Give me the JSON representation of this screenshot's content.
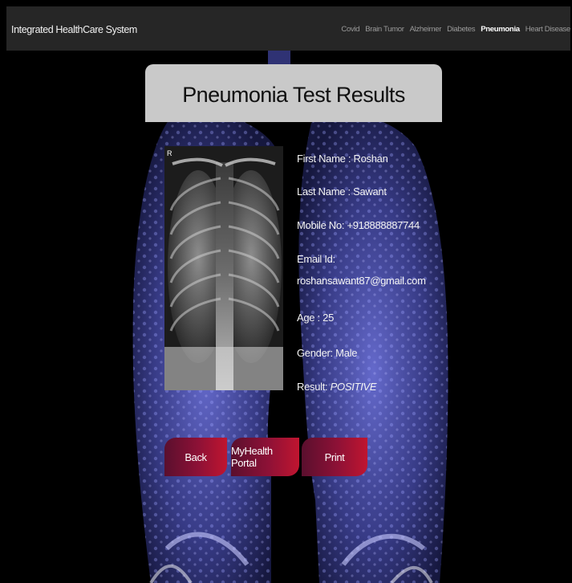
{
  "navbar": {
    "brand": "Integrated HealthCare System",
    "links": [
      "Covid",
      "Brain Tumor",
      "Alzheimer",
      "Diabetes",
      "Pneumonia",
      "Heart Disease"
    ],
    "active": "Pneumonia"
  },
  "title": "Pneumonia Test Results",
  "xray": {
    "corner_label": "R"
  },
  "patient": {
    "first_name": "First Name : Roshan",
    "last_name": "Last Name : Sawant",
    "mobile": "Mobile No: +918888887744",
    "email_label": "Email Id:",
    "email_value": "roshansawant87@gmail.com",
    "age": "Age : 25",
    "gender": "Gender: Male",
    "result_label": "Result: ",
    "result_value": "POSITIVE"
  },
  "buttons": {
    "back": "Back",
    "portal": "MyHealth Portal",
    "print": "Print"
  },
  "colors": {
    "navbar": "#262626",
    "title_panel": "#c9c9c9",
    "button_gradient_start": "#5a0f2e",
    "button_gradient_end": "#c01530",
    "lung_tint": "#4a4fb0"
  }
}
